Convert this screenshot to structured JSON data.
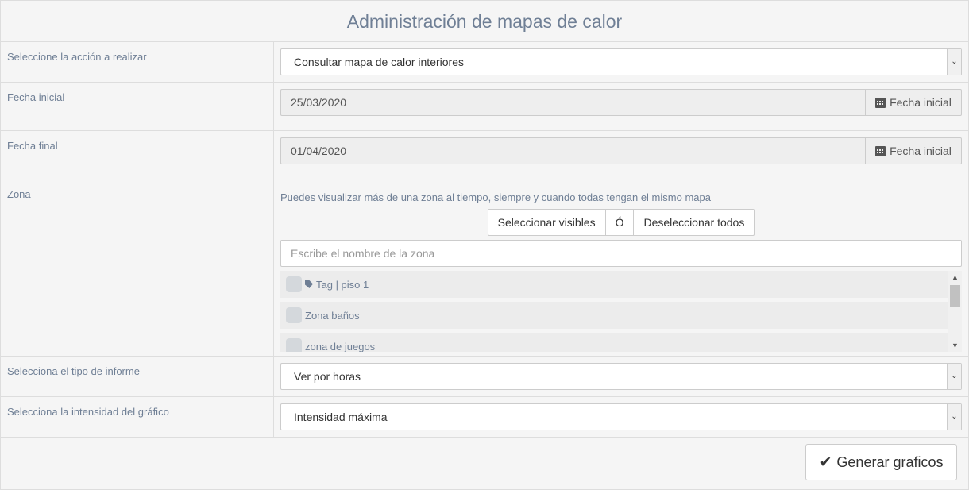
{
  "title": "Administración de mapas de calor",
  "action": {
    "label": "Seleccione la acción a realizar",
    "value": "Consultar mapa de calor interiores"
  },
  "start_date": {
    "label": "Fecha inicial",
    "value": "25/03/2020",
    "button": "Fecha inicial"
  },
  "end_date": {
    "label": "Fecha final",
    "value": "01/04/2020",
    "button": "Fecha inicial"
  },
  "zone": {
    "label": "Zona",
    "hint": "Puedes visualizar más de una zona al tiempo, siempre y cuando todas tengan el mismo mapa",
    "select_visible": "Seleccionar visibles",
    "separator": "Ó",
    "deselect_all": "Deseleccionar todos",
    "search_placeholder": "Escribe el nombre de la zona",
    "items": [
      {
        "label": "Tag | piso 1",
        "icon": "tag-icon"
      },
      {
        "label": "Zona baños"
      },
      {
        "label": "zona de juegos"
      }
    ]
  },
  "report_type": {
    "label": "Selecciona el tipo de informe",
    "value": "Ver por horas"
  },
  "intensity": {
    "label": "Selecciona la intensidad del gráfico",
    "value": "Intensidad máxima"
  },
  "generate": "Generar graficos"
}
